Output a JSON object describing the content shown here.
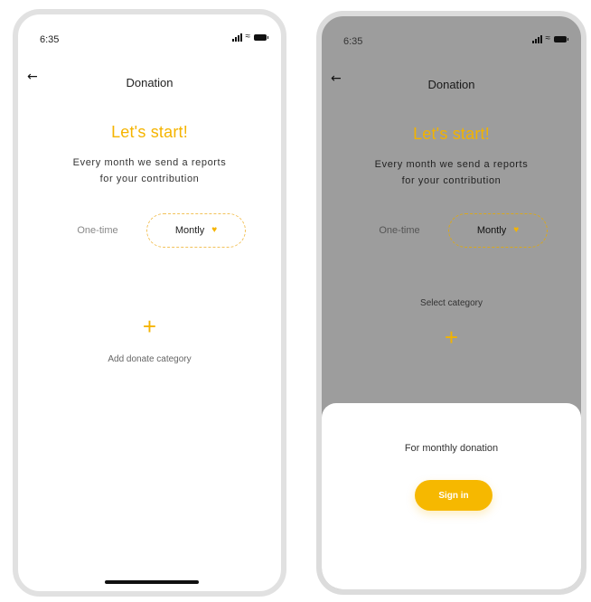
{
  "colors": {
    "accent": "#f5b400",
    "overlay": "#9d9d9d",
    "frame": "#e1e1e1"
  },
  "screen_a": {
    "status_time": "6:35",
    "header_title": "Donation",
    "heading": "Let's start!",
    "subtitle_line1": "Every month we send a reports",
    "subtitle_line2": "for your  contribution",
    "toggle": {
      "one_time": "One-time",
      "monthly": "Montly",
      "selected": "Montly"
    },
    "add_icon": "+",
    "add_caption": "Add donate category"
  },
  "screen_b": {
    "status_time": "6:35",
    "header_title": "Donation",
    "heading": "Let's start!",
    "subtitle_line1": "Every month we send a reports",
    "subtitle_line2": "for your  contribution",
    "toggle": {
      "one_time": "One-time",
      "monthly": "Montly"
    },
    "select_caption": "Select category",
    "add_icon": "+",
    "sheet": {
      "text": "For monthly donation",
      "button_label": "Sign in"
    }
  },
  "icons": {
    "back": "arrow-left-icon",
    "signal": "signal-icon",
    "wifi": "wifi-icon",
    "battery": "battery-icon",
    "favorite": "heart-icon",
    "add": "plus-icon"
  }
}
